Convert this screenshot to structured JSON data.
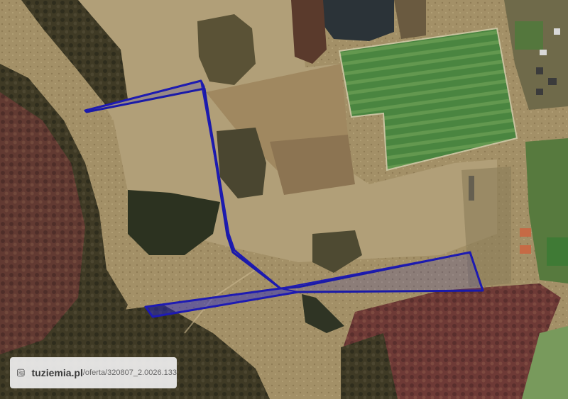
{
  "map": {
    "type": "aerial-photo",
    "boundary_color": "#1a1aa8",
    "colors": {
      "field_light": "#b0a07a",
      "field_dark": "#8a7a55",
      "forest": "#3d3a22",
      "crop_green": "#3f7a3a",
      "reddish_trees": "#6e3a36",
      "water": "#2b3338"
    }
  },
  "watermark": {
    "domain": "tuziemia.pl",
    "path": "/oferta/320807_2.0026.133",
    "icon": "map-logo-icon"
  }
}
